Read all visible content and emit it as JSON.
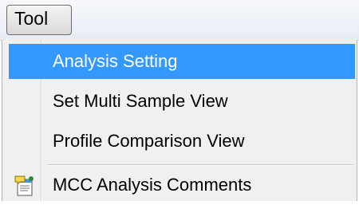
{
  "menubar": {
    "tool_label": "Tool"
  },
  "menu": {
    "items": [
      {
        "label": "Analysis Setting",
        "highlighted": true
      },
      {
        "label": "Set Multi Sample View"
      },
      {
        "label": "Profile Comparison View"
      },
      {
        "label": "MCC Analysis Comments",
        "icon": "comment-notepad-icon"
      }
    ]
  }
}
